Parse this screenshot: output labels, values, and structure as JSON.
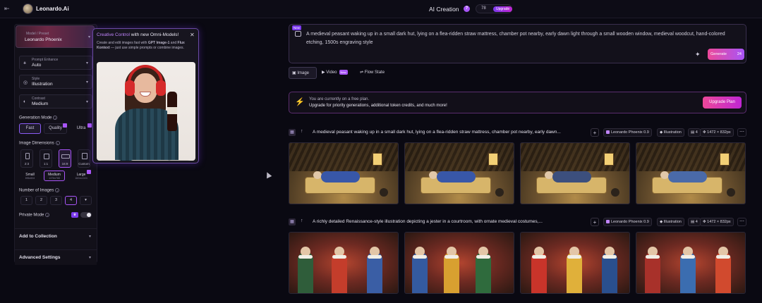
{
  "header": {
    "back_icon": "arrow-left-icon",
    "brand": "Leonardo.Ai",
    "center_title": "AI Creation",
    "token_count": "78",
    "upgrade_label": "Upgrade"
  },
  "sidebar": {
    "model_label": "Model / Preset",
    "model_value": "Leonardo Phoenix",
    "prompt_enhance_label": "Prompt Enhance",
    "prompt_enhance_value": "Auto",
    "style_label": "Style",
    "style_value": "Illustration",
    "contrast_label": "Contrast",
    "contrast_value": "Medium",
    "generation_mode_title": "Generation Mode",
    "modes": [
      "Fast",
      "Quality",
      "Ultra"
    ],
    "dimensions_title": "Image Dimensions",
    "dimensions": [
      "2:3",
      "1:1",
      "16:9",
      "Custom"
    ],
    "sizes": [
      {
        "label": "Small",
        "sub": "896x504"
      },
      {
        "label": "Medium",
        "sub": "1376x768"
      },
      {
        "label": "Large",
        "sub": "1824x1024"
      }
    ],
    "num_images_title": "Number of Images",
    "num_images": [
      "1",
      "2",
      "3",
      "4",
      "▾"
    ],
    "private_mode_label": "Private Mode",
    "add_to_collection": "Add to Collection",
    "advanced_settings": "Advanced Settings"
  },
  "popup": {
    "title_highlight": "Creative Control",
    "title_rest": " with new Omni-Models!",
    "desc_1": "Create and edit images fast with ",
    "desc_b1": "GPT Image-1",
    "desc_2": " and ",
    "desc_b2": "Flux Kontext",
    "desc_3": " — just use simple prompts or combine images.",
    "close_icon": "close-icon"
  },
  "prompt": {
    "new_tag": "New",
    "text": "A medieval peasant waking up in a small dark hut, lying on a flea-ridden straw mattress, chamber pot nearby, early dawn light through a small wooden window, medieval woodcut, hand-colored etching, 1500s engraving style",
    "generate_label": "Generate",
    "generate_cost": "24"
  },
  "tabs": [
    {
      "label": "Image"
    },
    {
      "label": "Video",
      "badge": "New"
    },
    {
      "label": "Flow State"
    }
  ],
  "banner": {
    "line1": "You are currently on a free plan.",
    "line2": "Upgrade for priority generations, additional token credits, and much more!",
    "button": "Upgrade Plan"
  },
  "generations": [
    {
      "title": "A medieval peasant waking up in a small dark hut, lying on a flea-ridden straw mattress, chamber pot nearby, early dawn...",
      "model": "Leonardo Phoenix 0.9",
      "style": "Illustration",
      "count": "4",
      "size": "1472 × 832px"
    },
    {
      "title": "A richly detailed Renaissance-style illustration depicting a jester in a courtroom, with ornate medieval costumes,...",
      "model": "Leonardo Phoenix 0.9",
      "style": "Illustration",
      "count": "4",
      "size": "1472 × 832px"
    }
  ],
  "colors": {
    "accent": "#a855f7",
    "pink": "#ec4899",
    "bg": "#0a0912"
  }
}
